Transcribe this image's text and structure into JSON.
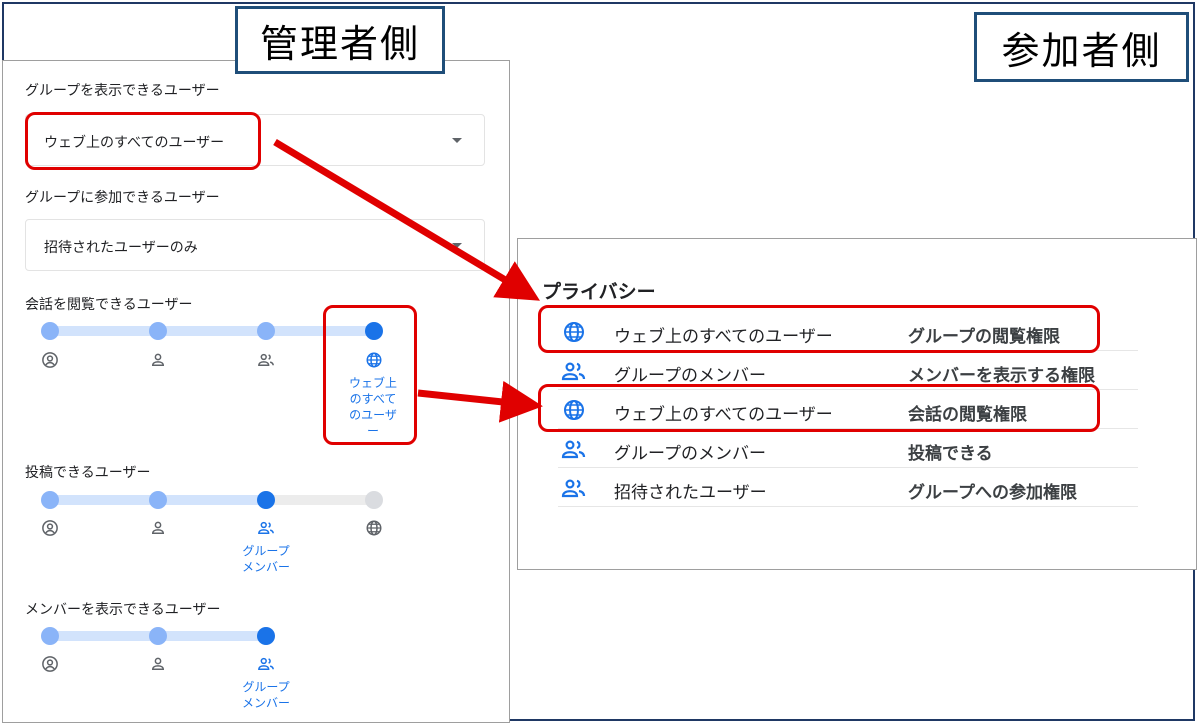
{
  "labels": {
    "admin": "管理者側",
    "member": "参加者側"
  },
  "admin": {
    "view_group": {
      "label": "グループを表示できるユーザー",
      "value": "ウェブ上のすべてのユーザー"
    },
    "join_group": {
      "label": "グループに参加できるユーザー",
      "value": "招待されたユーザーのみ"
    },
    "view_conversations": {
      "label": "会話を閲覧できるユーザー",
      "selected_caption": [
        "ウェブ上",
        "のすべて",
        "のユーザ",
        "ー"
      ],
      "icons": [
        "account-circle-icon",
        "person-icon",
        "group-icon",
        "globe-icon"
      ]
    },
    "post": {
      "label": "投稿できるユーザー",
      "selected_caption": [
        "グループ",
        "メンバー"
      ],
      "icons": [
        "account-circle-icon",
        "person-icon",
        "group-icon",
        "globe-icon"
      ]
    },
    "view_members": {
      "label": "メンバーを表示できるユーザー",
      "selected_caption": [
        "グループ",
        "メンバー"
      ],
      "icons": [
        "account-circle-icon",
        "person-icon",
        "group-icon"
      ]
    }
  },
  "member": {
    "title": "プライバシー",
    "rows": [
      {
        "icon": "globe-icon",
        "who": "ウェブ上のすべてのユーザー",
        "perm": "グループの閲覧権限"
      },
      {
        "icon": "group-icon",
        "who": "グループのメンバー",
        "perm": "メンバーを表示する権限"
      },
      {
        "icon": "globe-icon",
        "who": "ウェブ上のすべてのユーザー",
        "perm": "会話の閲覧権限"
      },
      {
        "icon": "group-icon",
        "who": "グループのメンバー",
        "perm": "投稿できる"
      },
      {
        "icon": "group-icon",
        "who": "招待されたユーザー",
        "perm": "グループへの参加権限"
      }
    ]
  },
  "colors": {
    "highlight": "#e00000",
    "accent": "#1a73e8",
    "track": "#d2e3fc",
    "label_border": "#1f4e79"
  }
}
